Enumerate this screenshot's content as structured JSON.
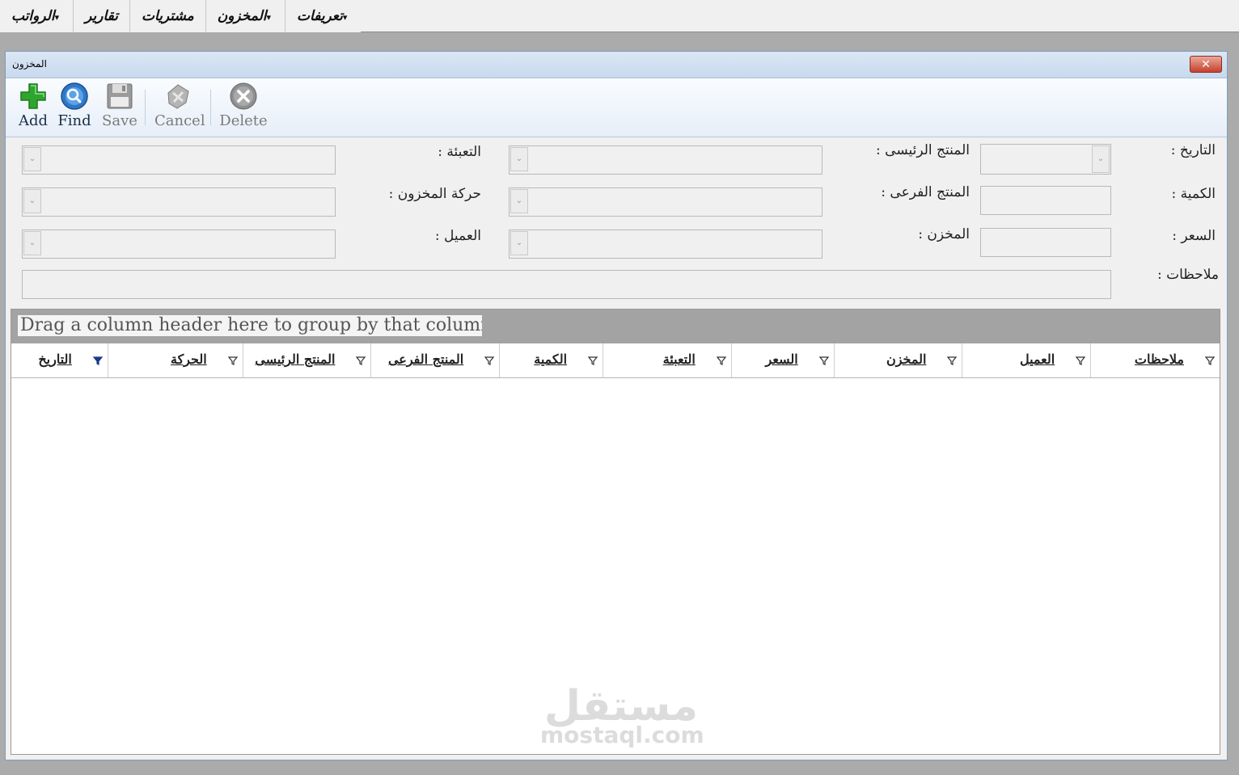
{
  "menu": {
    "items": [
      {
        "label": "تعريفات",
        "dropdown": true
      },
      {
        "label": "المخزون",
        "dropdown": true
      },
      {
        "label": "مشتريات",
        "dropdown": false
      },
      {
        "label": "تقارير",
        "dropdown": false
      },
      {
        "label": "الرواتب",
        "dropdown": true
      }
    ]
  },
  "window": {
    "title": "المخزون",
    "close_symbol": "✕"
  },
  "toolbar": {
    "add": "Add",
    "find": "Find",
    "save": "Save",
    "cancel": "Cancel",
    "delete": "Delete"
  },
  "form": {
    "date_label": "التاريخ :",
    "quantity_label": "الكمية :",
    "price_label": "السعر :",
    "notes_label": "ملاحظات :",
    "main_product_label": "المنتج الرئيسى :",
    "sub_product_label": "المنتج الفرعى :",
    "warehouse_label": "المخزن :",
    "packaging_label": "التعبئة :",
    "stock_movement_label": "حركة المخزون :",
    "client_label": "العميل :"
  },
  "grid": {
    "group_hint": "Drag a column header here to group by that column.",
    "columns": [
      "ملاحظات",
      "العميل",
      "المخزن",
      "السعر",
      "التعبئة",
      "الكمية",
      "المنتج الفرعى",
      "المنتج الرئيسى",
      "الحركة",
      "التاريخ"
    ],
    "active_filter_column": "التاريخ"
  },
  "watermark": {
    "arabic": "مستقل",
    "latin": "mostaql.com"
  },
  "colors": {
    "title_gradient": "#c8d9ee",
    "close_button": "#c7412c",
    "add_icon": "#2fa52f",
    "find_icon": "#2f78c9",
    "filter_active": "#1a3a8a"
  }
}
